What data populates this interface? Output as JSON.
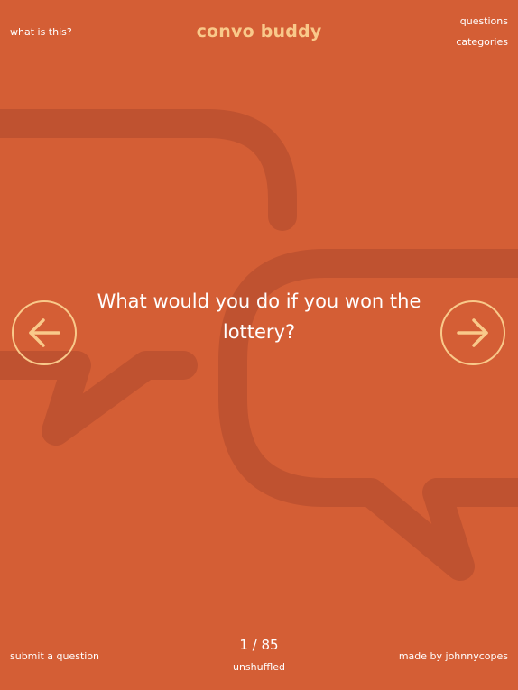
{
  "colors": {
    "background": "#d45e35",
    "accent": "#f9c98a",
    "shadow_art": "#bf5230",
    "text": "#ffffff"
  },
  "header": {
    "title": "convo buddy",
    "what_is_this": "what is this?",
    "questions_link": "questions",
    "categories_link": "categories"
  },
  "main": {
    "question": "What would you do if you won the lottery?",
    "prev_icon": "arrow-left-icon",
    "next_icon": "arrow-right-icon"
  },
  "footer": {
    "submit_link": "submit a question",
    "counter": "1 / 85",
    "shuffle_state": "unshuffled",
    "made_by": "made by johnnycopes"
  }
}
